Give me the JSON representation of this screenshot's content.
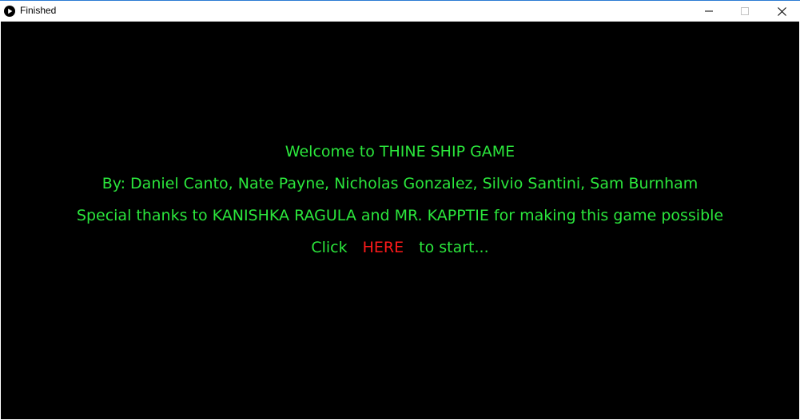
{
  "window": {
    "title": "Finished",
    "icon": "play-icon"
  },
  "controls": {
    "minimize_icon": "minimize-icon",
    "maximize_icon": "maximize-icon",
    "close_icon": "close-icon"
  },
  "colors": {
    "background": "#000000",
    "text": "#2be63c",
    "link": "#ff1a1a"
  },
  "screen": {
    "welcome": "Welcome to THINE SHIP GAME",
    "credits": "By: Daniel Canto, Nate Payne, Nicholas Gonzalez, Silvio Santini, Sam Burnham",
    "thanks": "Special thanks to KANISHKA RAGULA and MR. KAPPTIE for making this game possible",
    "click_prefix": "Click",
    "click_link": "HERE",
    "click_suffix": "to start..."
  }
}
